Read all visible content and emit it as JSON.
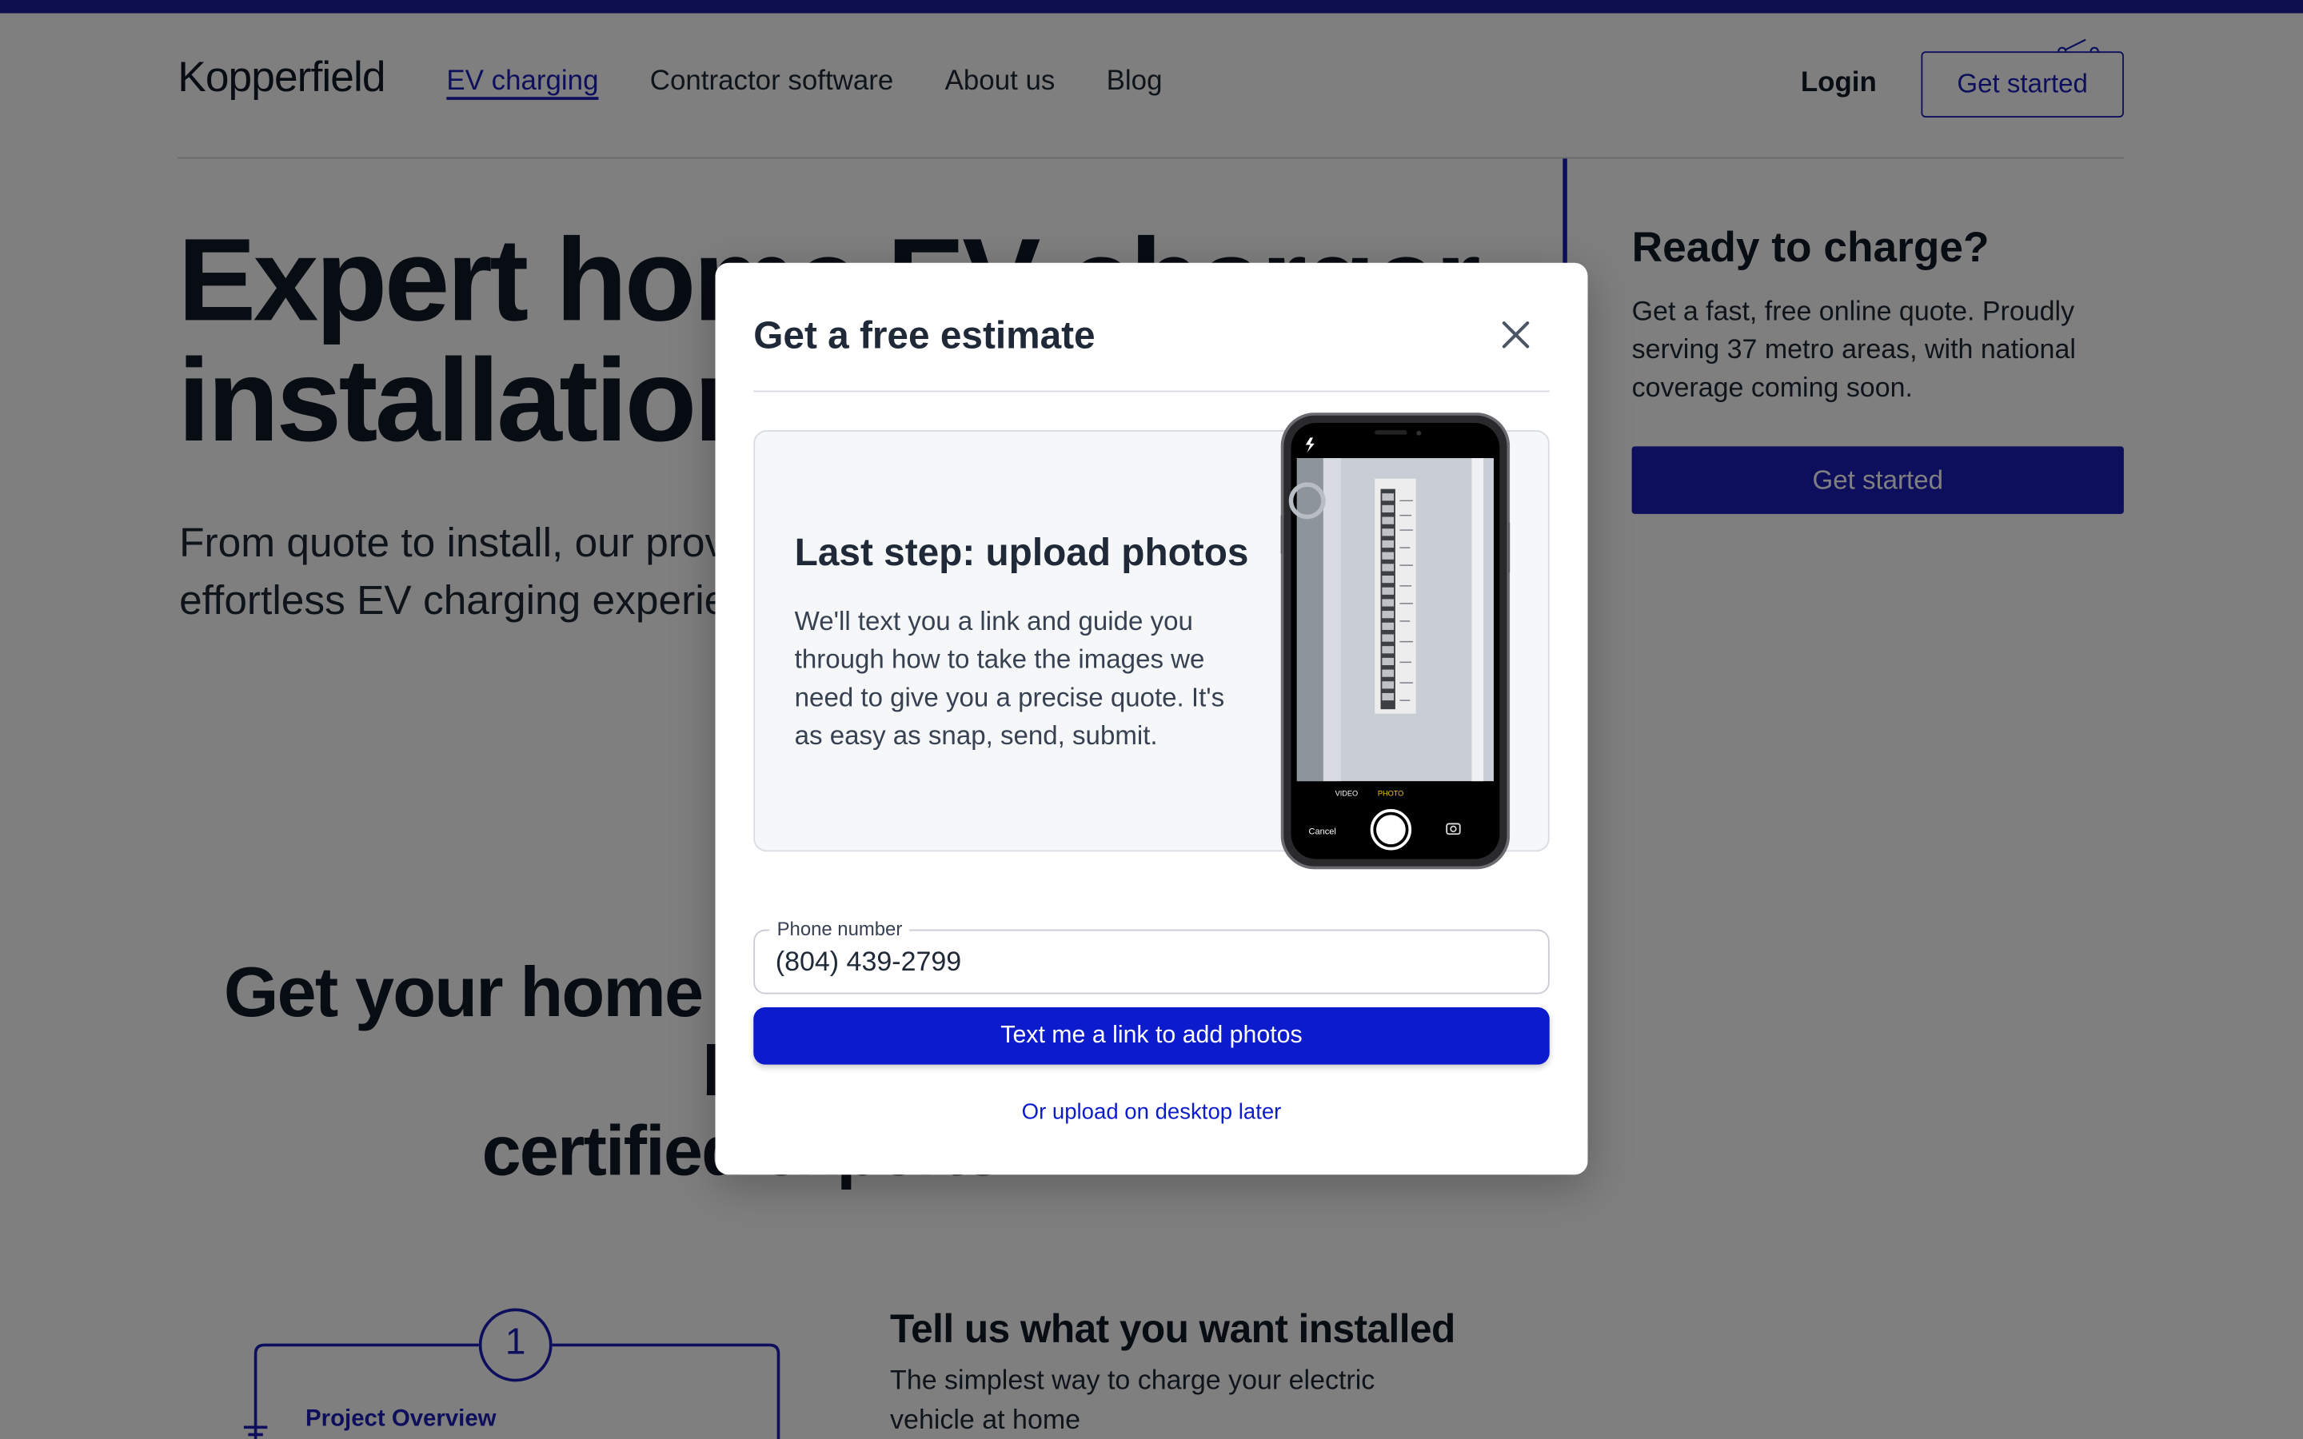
{
  "colors": {
    "brand": "#1a1fb8",
    "modal_button": "#0c1ccc",
    "overlay": "rgba(0,0,0,0.5)"
  },
  "header": {
    "logo": "Kopperfield",
    "nav": [
      {
        "label": "EV charging",
        "active": true
      },
      {
        "label": "Contractor software"
      },
      {
        "label": "About us"
      },
      {
        "label": "Blog"
      }
    ],
    "login": "Login",
    "cta": "Get started"
  },
  "hero": {
    "title_line1": "Expert home EV charger",
    "title_line2": "installation",
    "subtitle_line1": "From quote to install, our providers deliver an",
    "subtitle_line2": "effortless EV charging experience"
  },
  "sidebar": {
    "title": "Ready to charge?",
    "text": "Get a fast, free online quote. Proudly serving 37 metro areas, with national coverage coming soon.",
    "button": "Get started"
  },
  "section": {
    "title_line1": "Get your home charger installed by",
    "title_line2": "certified experts"
  },
  "step": {
    "number": "1",
    "label": "Project Overview",
    "title": "Tell us what you want installed",
    "text": "The simplest way to charge your electric vehicle at home"
  },
  "modal": {
    "title": "Get a free estimate",
    "close_icon": "close-icon",
    "card_title": "Last step: upload photos",
    "card_text": "We'll text you a link and guide you through how to take the images we need to give you a precise quote. It's as easy as snap, send, submit.",
    "phone_ui": {
      "video": "VIDEO",
      "photo": "PHOTO",
      "cancel": "Cancel"
    },
    "phone_field_label": "Phone number",
    "phone_value": "(804) 439-2799",
    "submit": "Text me a link to add photos",
    "alt_link": "Or upload on desktop later"
  }
}
